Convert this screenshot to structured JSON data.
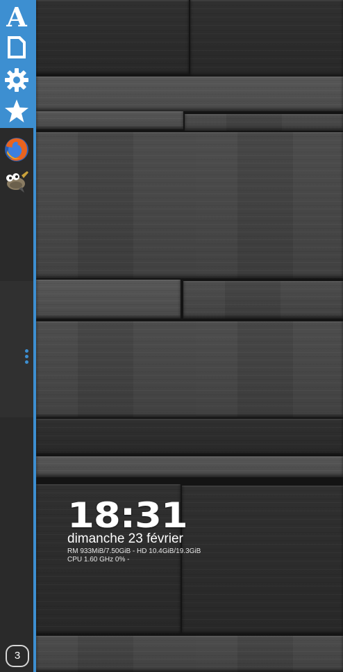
{
  "dock": {
    "launchers": [
      {
        "name": "text-editor",
        "icon": "letter-a-icon"
      },
      {
        "name": "files",
        "icon": "document-icon"
      },
      {
        "name": "settings",
        "icon": "gear-icon"
      },
      {
        "name": "favorites",
        "icon": "star-icon"
      }
    ],
    "apps": [
      {
        "name": "Firefox",
        "icon": "firefox-icon"
      },
      {
        "name": "GIMP",
        "icon": "gimp-icon"
      }
    ],
    "workspace_number": "3",
    "accent_color": "#3d8fd1"
  },
  "widget": {
    "time": "18:31",
    "date": "dimanche 23 février",
    "memory_line": "RM 933MiB/7.50GiB - HD 10.4GiB/19.3GiB",
    "cpu_line": "CPU 1.60 GHz 0% -"
  }
}
